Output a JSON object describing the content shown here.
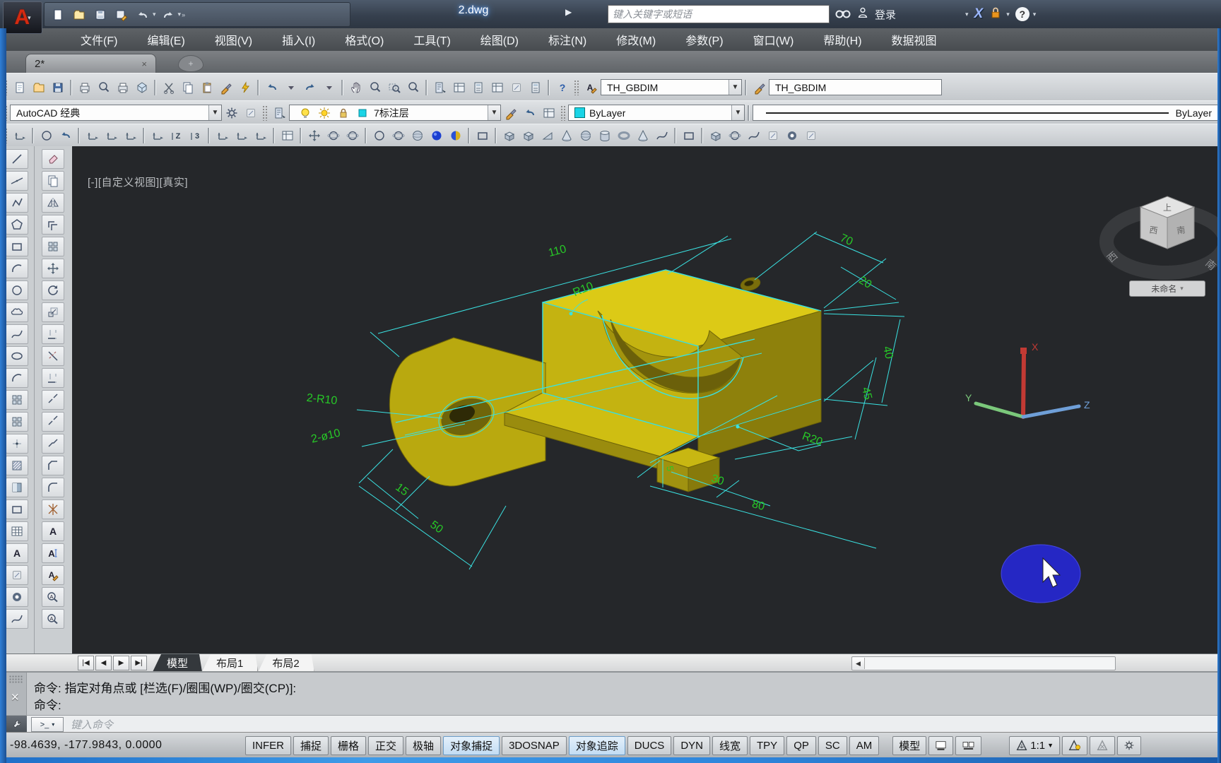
{
  "window": {
    "title": "2.dwg"
  },
  "titlebar": {
    "search_placeholder": "键入关键字或短语",
    "signin": "登录",
    "help": "?"
  },
  "menu": {
    "items": [
      "文件(F)",
      "编辑(E)",
      "视图(V)",
      "插入(I)",
      "格式(O)",
      "工具(T)",
      "绘图(D)",
      "标注(N)",
      "修改(M)",
      "参数(P)",
      "窗口(W)",
      "帮助(H)",
      "数据视图"
    ]
  },
  "file_tabs": {
    "active": "2*",
    "close": "×",
    "new": "+"
  },
  "toolbar1": {
    "icons": [
      {
        "n": "qnew",
        "g": "page"
      },
      {
        "n": "open",
        "g": "folder"
      },
      {
        "n": "save",
        "g": "disk"
      },
      {
        "n": "sep"
      },
      {
        "n": "plot",
        "g": "printer"
      },
      {
        "n": "plot-preview",
        "g": "lens"
      },
      {
        "n": "publish",
        "g": "printer"
      },
      {
        "n": "export-dwf",
        "g": "hex"
      },
      {
        "n": "sep"
      },
      {
        "n": "cut",
        "g": "scissors"
      },
      {
        "n": "copy-clip",
        "g": "copy"
      },
      {
        "n": "paste",
        "g": "clip"
      },
      {
        "n": "match-properties",
        "g": "brush"
      },
      {
        "n": "quick-select",
        "g": "bolt"
      },
      {
        "n": "sep"
      },
      {
        "n": "undo",
        "g": "undo"
      },
      {
        "n": "undo-list",
        "g": "dd"
      },
      {
        "n": "redo",
        "g": "redo"
      },
      {
        "n": "redo-list",
        "g": "dd"
      },
      {
        "n": "sep"
      },
      {
        "n": "pan",
        "g": "hand"
      },
      {
        "n": "zoom-realtime",
        "g": "lens"
      },
      {
        "n": "zoom-window",
        "g": "zoomw"
      },
      {
        "n": "zoom-previous",
        "g": "lens"
      },
      {
        "n": "sep"
      },
      {
        "n": "properties",
        "g": "props"
      },
      {
        "n": "design-center",
        "g": "grid2"
      },
      {
        "n": "tool-palettes",
        "g": "calc"
      },
      {
        "n": "sheet-set-manager",
        "g": "grid2"
      },
      {
        "n": "markup",
        "g": "def"
      },
      {
        "n": "quick-calc",
        "g": "calc"
      },
      {
        "n": "sep"
      },
      {
        "n": "help",
        "g": "help"
      }
    ],
    "text_style_icon": "Ae",
    "text_style": "TH_GBDIM",
    "dim_style_icon": "brush",
    "dim_style": "TH_GBDIM"
  },
  "toolbar2": {
    "workspace": "AutoCAD 经典",
    "layer": "7标注层",
    "color": "ByLayer",
    "linetype": "ByLayer",
    "layer_icons": [
      {
        "n": "layer-properties",
        "g": "props"
      }
    ],
    "layer_state_icons": [
      {
        "n": "layer-on-bulb",
        "g": "bulb"
      },
      {
        "n": "layer-freeze-sun",
        "g": "sun"
      },
      {
        "n": "layer-lock",
        "g": "lock"
      },
      {
        "n": "layer-color-swatch",
        "g": "sqcyan"
      }
    ],
    "layer_tool_icons": [
      {
        "n": "make-object-layer-current",
        "g": "brush"
      },
      {
        "n": "layer-previous",
        "g": "undo"
      },
      {
        "n": "layer-states",
        "g": "grid2"
      }
    ]
  },
  "toolbar3": {
    "icons": [
      {
        "n": "ucs",
        "g": "ucs"
      },
      {
        "n": "sep"
      },
      {
        "n": "ucs-world",
        "g": "circ"
      },
      {
        "n": "ucs-previous",
        "g": "undo"
      },
      {
        "n": "sep"
      },
      {
        "n": "ucs-object",
        "g": "ucs"
      },
      {
        "n": "ucs-face",
        "g": "ucs"
      },
      {
        "n": "ucs-view",
        "g": "ucs"
      },
      {
        "n": "sep"
      },
      {
        "n": "ucs-origin",
        "g": "ucs"
      },
      {
        "n": "ucs-z-axis",
        "g": "Z"
      },
      {
        "n": "ucs-3point",
        "g": "N3"
      },
      {
        "n": "sep"
      },
      {
        "n": "ucs-x",
        "g": "ucs"
      },
      {
        "n": "ucs-y",
        "g": "ucs"
      },
      {
        "n": "ucs-z",
        "g": "ucs"
      },
      {
        "n": "sep"
      },
      {
        "n": "named-ucs",
        "g": "grid2"
      },
      {
        "n": "sep"
      },
      {
        "n": "3d-pan",
        "g": "move"
      },
      {
        "n": "constrained-orbit",
        "g": "orb"
      },
      {
        "n": "free-orbit",
        "g": "orb"
      },
      {
        "n": "sep"
      },
      {
        "n": "vs-2d-wireframe",
        "g": "circ"
      },
      {
        "n": "vs-wireframe",
        "g": "orb"
      },
      {
        "n": "vs-hidden",
        "g": "sph"
      },
      {
        "n": "vs-realistic",
        "g": "ballb"
      },
      {
        "n": "vs-conceptual",
        "g": "balld"
      },
      {
        "n": "sep"
      },
      {
        "n": "section-plane",
        "g": "rect"
      },
      {
        "n": "sep"
      },
      {
        "n": "polysolid",
        "g": "box3"
      },
      {
        "n": "box",
        "g": "box3"
      },
      {
        "n": "wedge",
        "g": "wedge"
      },
      {
        "n": "cone",
        "g": "cone"
      },
      {
        "n": "sphere",
        "g": "sph"
      },
      {
        "n": "cylinder",
        "g": "cyl"
      },
      {
        "n": "torus",
        "g": "torus"
      },
      {
        "n": "pyramid",
        "g": "cone"
      },
      {
        "n": "helix",
        "g": "spl"
      },
      {
        "n": "sep"
      },
      {
        "n": "planar-surface",
        "g": "rect"
      },
      {
        "n": "sep"
      },
      {
        "n": "extrude",
        "g": "box3"
      },
      {
        "n": "revolve",
        "g": "orb"
      },
      {
        "n": "sweep",
        "g": "spl"
      },
      {
        "n": "loft",
        "g": "def"
      },
      {
        "n": "union",
        "g": "donut"
      },
      {
        "n": "subtract",
        "g": "def"
      }
    ]
  },
  "draw_toolbar": {
    "icons": [
      {
        "n": "line",
        "g": "line"
      },
      {
        "n": "construction-line",
        "g": "cline"
      },
      {
        "n": "polyline",
        "g": "pline"
      },
      {
        "n": "polygon",
        "g": "pent"
      },
      {
        "n": "rectangle",
        "g": "rect"
      },
      {
        "n": "arc",
        "g": "arc"
      },
      {
        "n": "circle",
        "g": "circ"
      },
      {
        "n": "revision-cloud",
        "g": "cloud"
      },
      {
        "n": "spline",
        "g": "spl"
      },
      {
        "n": "ellipse",
        "g": "ell"
      },
      {
        "n": "ellipse-arc",
        "g": "arc"
      },
      {
        "n": "insert-block",
        "g": "blk"
      },
      {
        "n": "create-block",
        "g": "blk"
      },
      {
        "n": "point",
        "g": "pt"
      },
      {
        "n": "hatch",
        "g": "hatch"
      },
      {
        "n": "gradient",
        "g": "grad"
      },
      {
        "n": "region",
        "g": "rect"
      },
      {
        "n": "table",
        "g": "table"
      },
      {
        "n": "multiline-text",
        "g": "A"
      },
      {
        "n": "add-selected",
        "g": "def"
      },
      {
        "n": "donut",
        "g": "donut"
      },
      {
        "n": "helix-2d",
        "g": "spl"
      }
    ]
  },
  "modify_toolbar": {
    "icons": [
      {
        "n": "erase",
        "g": "erase"
      },
      {
        "n": "copy",
        "g": "copy"
      },
      {
        "n": "mirror",
        "g": "mir"
      },
      {
        "n": "offset",
        "g": "off"
      },
      {
        "n": "array",
        "g": "blk"
      },
      {
        "n": "move",
        "g": "move"
      },
      {
        "n": "rotate",
        "g": "rot"
      },
      {
        "n": "scale",
        "g": "scl"
      },
      {
        "n": "stretch",
        "g": "ext"
      },
      {
        "n": "trim",
        "g": "trm"
      },
      {
        "n": "extend",
        "g": "ext"
      },
      {
        "n": "break-at-point",
        "g": "brk"
      },
      {
        "n": "break",
        "g": "brk"
      },
      {
        "n": "join",
        "g": "join"
      },
      {
        "n": "chamfer",
        "g": "cham"
      },
      {
        "n": "fillet",
        "g": "fil"
      },
      {
        "n": "explode",
        "g": "expl"
      },
      {
        "n": "mtext",
        "g": "A"
      },
      {
        "n": "single-line-text",
        "g": "Ai"
      },
      {
        "n": "edit-text",
        "g": "Ae"
      },
      {
        "n": "find",
        "g": "Af"
      },
      {
        "n": "spell-check",
        "g": "Af"
      }
    ]
  },
  "viewport": {
    "view_label": "[-][自定义视图][真实]",
    "viewcube": {
      "top": "上",
      "left": "西",
      "right": "南",
      "ring_left": "西",
      "ring_right": "南",
      "unnamed": "未命名"
    },
    "dims": {
      "d110": "110",
      "r10": "R10",
      "d70": "70",
      "d20": "20",
      "d40": "40",
      "d45": "45",
      "r20": "R20",
      "d2r10": "2-R10",
      "d2o10": "2-ø10",
      "d15": "15",
      "d50": "50",
      "d30": "30",
      "d80": "80",
      "d5": "5"
    },
    "ucs": {
      "x": "X",
      "y": "Y",
      "z": "Z"
    }
  },
  "layout_tabs": {
    "model": "模型",
    "layout1": "布局1",
    "layout2": "布局2"
  },
  "command": {
    "line1": "命令: 指定对角点或 [栏选(F)/圈围(WP)/圈交(CP)]:",
    "line2": "命令:",
    "placeholder": "键入命令",
    "prompt": ">_"
  },
  "status": {
    "coords": "-98.4639,  -177.9843,  0.0000",
    "toggles": [
      {
        "label": "INFER",
        "active": false
      },
      {
        "label": "捕捉",
        "active": false
      },
      {
        "label": "栅格",
        "active": false
      },
      {
        "label": "正交",
        "active": false
      },
      {
        "label": "极轴",
        "active": false
      },
      {
        "label": "对象捕捉",
        "active": true
      },
      {
        "label": "3DOSNAP",
        "active": false
      },
      {
        "label": "对象追踪",
        "active": true
      },
      {
        "label": "DUCS",
        "active": false
      },
      {
        "label": "DYN",
        "active": false
      },
      {
        "label": "线宽",
        "active": false
      },
      {
        "label": "TPY",
        "active": false
      },
      {
        "label": "QP",
        "active": false
      },
      {
        "label": "SC",
        "active": false
      },
      {
        "label": "AM",
        "active": false
      }
    ],
    "model_btn": "模型",
    "scale": "1:1"
  },
  "colors": {
    "accent_cyan": "#3ae2e2",
    "dim_green": "#27c927",
    "model_yellow": "#d8c614",
    "viewport_bg": "#25272a"
  }
}
